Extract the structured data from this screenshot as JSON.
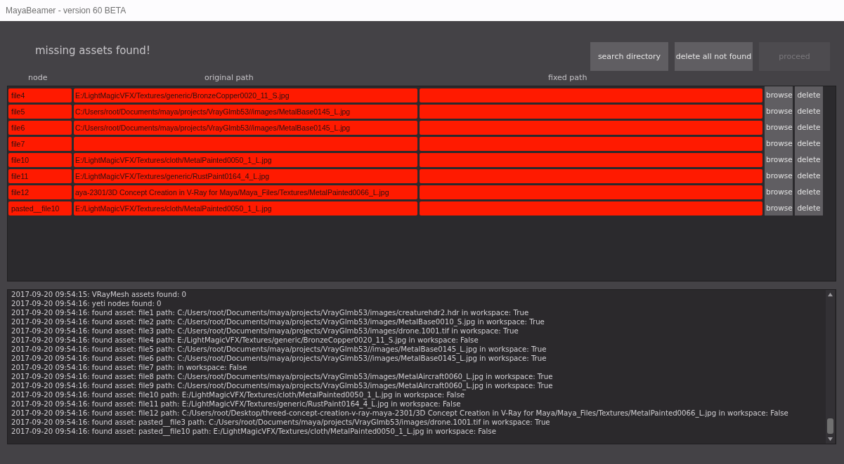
{
  "window": {
    "title": "MayaBeamer - version 60 BETA"
  },
  "heading": "missing assets found!",
  "buttons": [
    {
      "label": "search directory",
      "disabled": false
    },
    {
      "label": "delete all not found",
      "disabled": false
    },
    {
      "label": "proceed",
      "disabled": true
    }
  ],
  "columns": [
    "node",
    "original path",
    "fixed path"
  ],
  "rows": [
    {
      "node": "file4",
      "original_path": "E:/LightMagicVFX/Textures/generic/BronzeCopper0020_11_S.jpg",
      "found": false,
      "browse": "browse",
      "delete": "delete"
    },
    {
      "node": "file5",
      "original_path": "C:/Users/root/Documents/maya/projects/VrayGlmb53//images/MetalBase0145_L.jpg",
      "found": false,
      "browse": "browse",
      "delete": "delete"
    },
    {
      "node": "file6",
      "original_path": "C:/Users/root/Documents/maya/projects/VrayGlmb53//images/MetalBase0145_L.jpg",
      "found": false,
      "browse": "browse",
      "delete": "delete"
    },
    {
      "node": "file7",
      "found": false,
      "browse": "browse",
      "delete": "delete"
    },
    {
      "node": "file10",
      "original_path": "E:/LightMagicVFX/Textures/cloth/MetalPainted0050_1_L.jpg",
      "found": false,
      "browse": "browse",
      "delete": "delete"
    },
    {
      "node": "file11",
      "original_path": "E:/LightMagicVFX/Textures/generic/RustPaint0164_4_L.jpg",
      "found": false,
      "browse": "browse",
      "delete": "delete"
    },
    {
      "node": "file12",
      "original_path": "aya-2301/3D Concept Creation in V-Ray for Maya/Maya_Files/Textures/MetalPainted0066_L.jpg",
      "found": false,
      "browse": "browse",
      "delete": "delete"
    },
    {
      "node": "pasted__file10",
      "original_path": "E:/LightMagicVFX/Textures/cloth/MetalPainted0050_1_L.jpg",
      "found": false,
      "browse": "browse",
      "delete": "delete"
    }
  ],
  "log": [
    "2017-09-20 09:54:15: VRayMesh assets found: 0",
    "2017-09-20 09:54:16: yeti nodes found: 0",
    "2017-09-20 09:54:16: found asset: file1 path: C:/Users/root/Documents/maya/projects/VrayGlmb53/images/creaturehdr2.hdr in workspace: True",
    "2017-09-20 09:54:16: found asset: file2 path: C:/Users/root/Documents/maya/projects/VrayGlmb53/images/MetalBase0010_S.jpg in workspace: True",
    "2017-09-20 09:54:16: found asset: file3 path: C:/Users/root/Documents/maya/projects/VrayGlmb53/images/drone.1001.tif in workspace: True",
    "2017-09-20 09:54:16: found asset: file4 path: E:/LightMagicVFX/Textures/generic/BronzeCopper0020_11_S.jpg in workspace: False",
    "2017-09-20 09:54:16: found asset: file5 path: C:/Users/root/Documents/maya/projects/VrayGlmb53//images/MetalBase0145_L.jpg in workspace: True",
    "2017-09-20 09:54:16: found asset: file6 path: C:/Users/root/Documents/maya/projects/VrayGlmb53//images/MetalBase0145_L.jpg in workspace: True",
    "2017-09-20 09:54:16: found asset: file7 path:  in workspace: False",
    "2017-09-20 09:54:16: found asset: file8 path: C:/Users/root/Documents/maya/projects/VrayGlmb53/images/MetalAircraft0060_L.jpg in workspace: True",
    "2017-09-20 09:54:16: found asset: file9 path: C:/Users/root/Documents/maya/projects/VrayGlmb53/images/MetalAircraft0060_L.jpg in workspace: True",
    "2017-09-20 09:54:16: found asset: file10 path: E:/LightMagicVFX/Textures/cloth/MetalPainted0050_1_L.jpg in workspace: False",
    "2017-09-20 09:54:16: found asset: file11 path: E:/LightMagicVFX/Textures/generic/RustPaint0164_4_L.jpg in workspace: False",
    "2017-09-20 09:54:16: found asset: file12 path: C:/Users/root/Desktop/threed-concept-creation-v-ray-maya-2301/3D Concept Creation in V-Ray for Maya/Maya_Files/Textures/MetalPainted0066_L.jpg in workspace: False",
    "2017-09-20 09:54:16: found asset: pasted__file3 path: C:/Users/root/Documents/maya/projects/VrayGlmb53/images/drone.1001.tif in workspace: True",
    "2017-09-20 09:54:16: found asset: pasted__file10 path: E:/LightMagicVFX/Textures/cloth/MetalPainted0050_1_L.jpg in workspace: False"
  ]
}
